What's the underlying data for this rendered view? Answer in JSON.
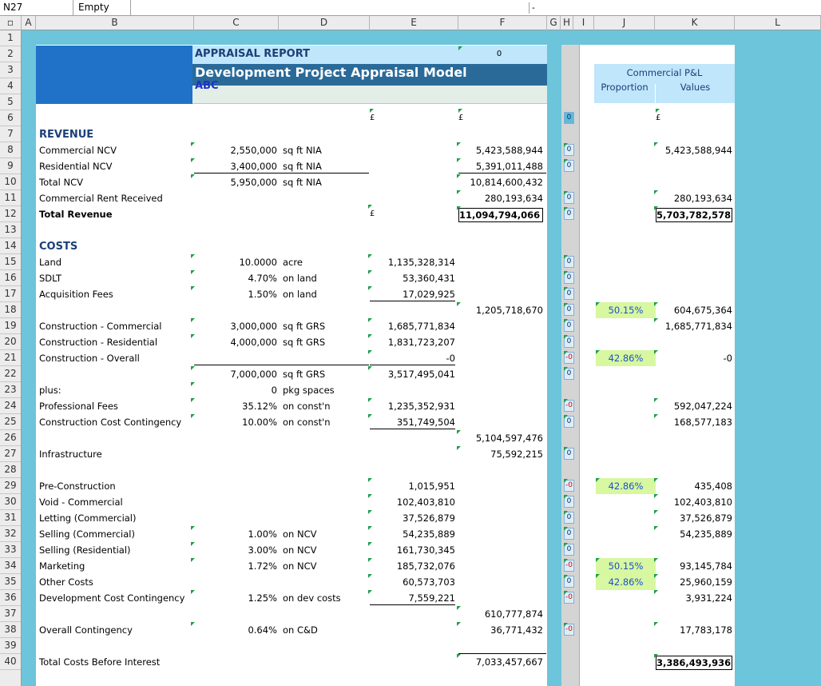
{
  "formula_bar": {
    "name_box": "N27",
    "formula_content": "Empty",
    "fx_dash": "-"
  },
  "columns": [
    "A",
    "B",
    "C",
    "D",
    "E",
    "F",
    "G",
    "H",
    "I",
    "J",
    "K",
    "L"
  ],
  "rows": [
    "1",
    "2",
    "3",
    "4",
    "5",
    "6",
    "7",
    "8",
    "9",
    "10",
    "11",
    "12",
    "13",
    "14",
    "15",
    "16",
    "17",
    "18",
    "19",
    "20",
    "21",
    "22",
    "23",
    "24",
    "25",
    "26",
    "27",
    "28",
    "29",
    "30",
    "31",
    "32",
    "33",
    "34",
    "35",
    "36",
    "37",
    "38",
    "39",
    "40"
  ],
  "header": {
    "report_label": "APPRAISAL REPORT",
    "report_value": "0",
    "model_title": "Development Project Appraisal Model",
    "company": "ABC",
    "pl_title": "Commercial P&L",
    "pl_col_proportion": "Proportion",
    "pl_col_values": "Values"
  },
  "currency": {
    "e": "£",
    "f": "£",
    "k": "£",
    "e12": "£"
  },
  "sections": {
    "revenue": "REVENUE",
    "costs": "COSTS"
  },
  "revenue": [
    {
      "label": "Commercial NCV",
      "qty": "2,550,000",
      "unit": "sq ft NIA",
      "f": "5,423,588,944",
      "g": "0",
      "k": "5,423,588,944"
    },
    {
      "label": "Residential NCV",
      "qty": "3,400,000",
      "unit": "sq ft NIA",
      "f": "5,391,011,488",
      "g": "0",
      "k": ""
    },
    {
      "label": "Total NCV",
      "qty": "5,950,000",
      "unit": "sq ft NIA",
      "f": "10,814,600,432",
      "g": "",
      "k": ""
    },
    {
      "label": "Commercial Rent Received",
      "qty": "",
      "unit": "",
      "f": "280,193,634",
      "g": "0",
      "k": "280,193,634"
    },
    {
      "label": "Total Revenue",
      "qty": "",
      "unit": "",
      "f": "11,094,794,066",
      "g": "0",
      "k": "5,703,782,578"
    }
  ],
  "costs": {
    "land": {
      "label": "Land",
      "qty": "10.0000",
      "unit": "acre",
      "e": "1,135,328,314",
      "g": "0"
    },
    "sdlt": {
      "label": "SDLT",
      "qty": "4.70%",
      "unit": "on land",
      "e": "53,360,431",
      "g": "0"
    },
    "acq": {
      "label": "Acquisition Fees",
      "qty": "1.50%",
      "unit": "on land",
      "e": "17,029,925",
      "g": "0"
    },
    "r18": {
      "f": "1,205,718,670",
      "g": "0",
      "j": "50.15%",
      "k": "604,675,364"
    },
    "cc": {
      "label": "Construction - Commercial",
      "qty": "3,000,000",
      "unit": "sq ft GRS",
      "e": "1,685,771,834",
      "g": "0",
      "k": "1,685,771,834"
    },
    "cr": {
      "label": "Construction - Residential",
      "qty": "4,000,000",
      "unit": "sq ft GRS",
      "e": "1,831,723,207",
      "g": "0"
    },
    "co": {
      "label": "Construction - Overall",
      "e": "-0",
      "g": "-0",
      "j": "42.86%",
      "k": "-0"
    },
    "r22": {
      "qty": "7,000,000",
      "unit": "sq ft GRS",
      "e": "3,517,495,041",
      "g": "0"
    },
    "plus": {
      "label": "plus:",
      "qty": "0",
      "unit": "pkg spaces"
    },
    "pf": {
      "label": "Professional Fees",
      "qty": "35.12%",
      "unit": "on const'n",
      "e": "1,235,352,931",
      "g": "-0",
      "k": "592,047,224"
    },
    "ccc": {
      "label": "Construction Cost Contingency",
      "qty": "10.00%",
      "unit": "on const'n",
      "e": "351,749,504",
      "g": "0",
      "k": "168,577,183"
    },
    "r26": {
      "f": "5,104,597,476"
    },
    "infra": {
      "label": "Infrastructure",
      "f": "75,592,215",
      "g": "0"
    },
    "list": [
      {
        "label": "Pre-Construction",
        "qty": "",
        "unit": "",
        "e": "1,015,951",
        "g": "-0",
        "j": "42.86%",
        "k": "435,408"
      },
      {
        "label": "Void - Commercial",
        "qty": "",
        "unit": "",
        "e": "102,403,810",
        "g": "0",
        "j": "",
        "k": "102,403,810"
      },
      {
        "label": "Letting (Commercial)",
        "qty": "",
        "unit": "",
        "e": "37,526,879",
        "g": "0",
        "j": "",
        "k": "37,526,879"
      },
      {
        "label": "Selling (Commercial)",
        "qty": "1.00%",
        "unit": "on NCV",
        "e": "54,235,889",
        "g": "0",
        "j": "",
        "k": "54,235,889"
      },
      {
        "label": "Selling (Residential)",
        "qty": "3.00%",
        "unit": "on NCV",
        "e": "161,730,345",
        "g": "0",
        "j": "",
        "k": ""
      },
      {
        "label": "Marketing",
        "qty": "1.72%",
        "unit": "on NCV",
        "e": "185,732,076",
        "g": "-0",
        "j": "50.15%",
        "k": "93,145,784"
      },
      {
        "label": "Other Costs",
        "qty": "",
        "unit": "",
        "e": "60,573,703",
        "g": "0",
        "j": "42.86%",
        "k": "25,960,159"
      },
      {
        "label": "Development Cost Contingency",
        "qty": "1.25%",
        "unit": "on dev costs",
        "e": "7,559,221",
        "g": "-0",
        "j": "",
        "k": "3,931,224"
      }
    ],
    "r37": {
      "f": "610,777,874"
    },
    "oc": {
      "label": "Overall Contingency",
      "qty": "0.64%",
      "unit": "on C&D",
      "f": "36,771,432",
      "g": "-0",
      "k": "17,783,178"
    },
    "tcbi": {
      "label": "Total Costs Before Interest",
      "f": "7,033,457,667",
      "k": "3,386,493,936"
    }
  }
}
